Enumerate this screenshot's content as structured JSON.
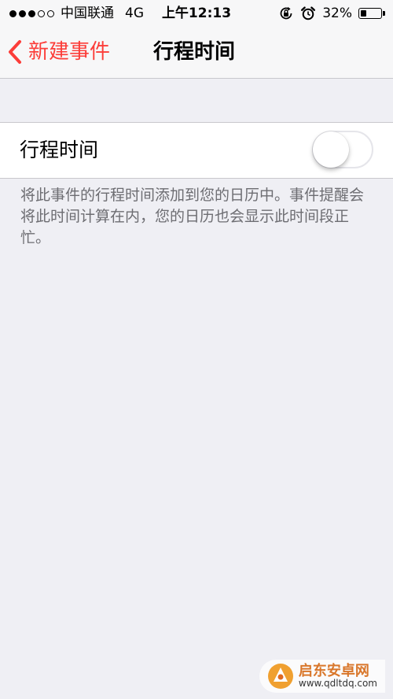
{
  "status_bar": {
    "signal_bars_filled": 3,
    "signal_bars_total": 5,
    "carrier": "中国联通",
    "network": "4G",
    "time": "上午12:13",
    "battery_text": "32%",
    "battery_level": 0.32,
    "icons": [
      "orientation-lock-icon",
      "alarm-icon"
    ]
  },
  "nav": {
    "back_label": "新建事件",
    "title": "行程时间"
  },
  "setting": {
    "label": "行程时间",
    "toggle_on": false
  },
  "footer_text": "将此事件的行程时间添加到您的日历中。事件提醒会将此时间计算在内，您的日历也会显示此时间段正忙。",
  "watermark": {
    "name": "启东安卓网",
    "url": "www.qdltdq.com"
  },
  "colors": {
    "accent": "#fc3d39",
    "background": "#efeff4",
    "nav_background": "#f7f7f8",
    "footer_text": "#6d6d72"
  }
}
